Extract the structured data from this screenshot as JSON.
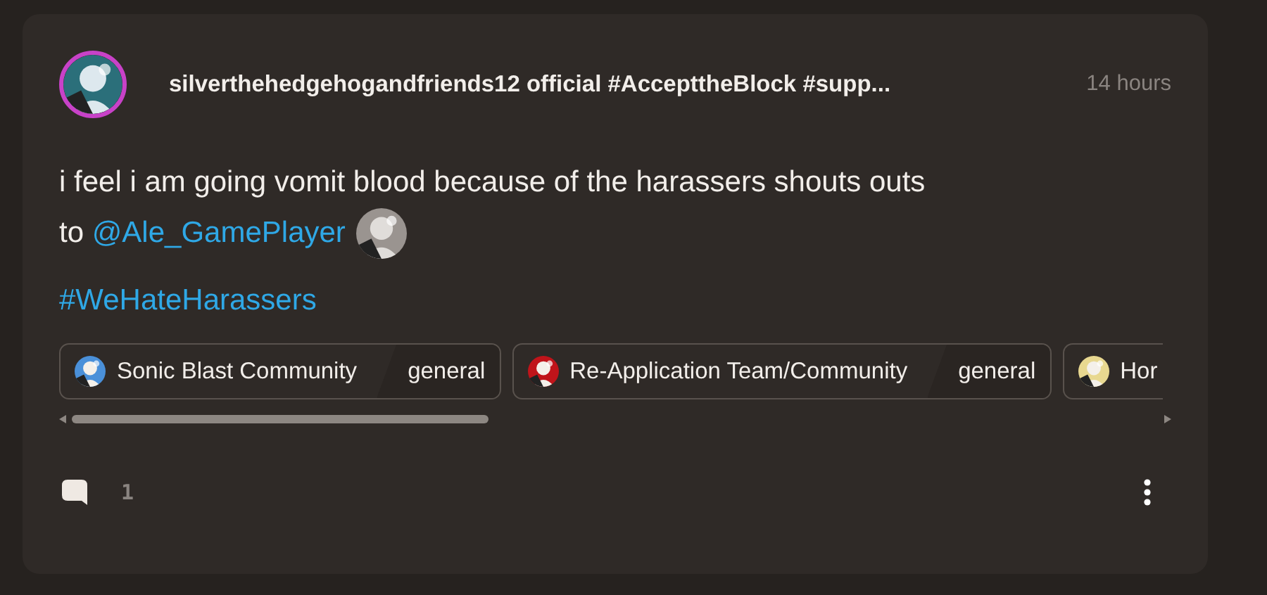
{
  "post": {
    "author": "silverthehedgehogandfriends12 official #AccepttheBlock #supp...",
    "time": "14 hours",
    "body_lines": [
      {
        "text": "i feel i am going vomit blood because of the harassers shouts outs"
      },
      {
        "text": "to ",
        "mention": "@Ale_GamePlayer"
      }
    ],
    "hashtag": "#WeHateHarassers",
    "communities": [
      {
        "name": "Sonic Blast Community",
        "channel": "general",
        "color": "#4a90d9"
      },
      {
        "name": "Re-Application Team/Community",
        "channel": "general",
        "color": "#c0141a"
      },
      {
        "name": "Hor",
        "color": "#e8d890"
      }
    ],
    "comment_count": "1"
  }
}
